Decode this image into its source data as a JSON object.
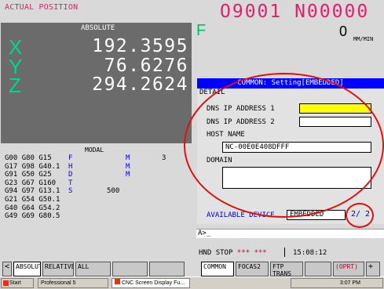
{
  "header": {
    "title": "ACTUAL POSITION",
    "program": "O9001 N00000"
  },
  "position": {
    "title": "ABSOLUTE",
    "axes": [
      {
        "name": "X",
        "value": "192.3595"
      },
      {
        "name": "Y",
        "value": "76.6276"
      },
      {
        "name": "Z",
        "value": "294.2624"
      }
    ]
  },
  "feed": {
    "label": "F",
    "value": "0",
    "unit": "MM/MIN"
  },
  "modal": {
    "title": "MODAL",
    "rows": [
      {
        "c1": "G00",
        "c2": "G80",
        "c3": "G15",
        "c4": "F",
        "c5": "",
        "c6": "M",
        "c7": "3"
      },
      {
        "c1": "G17",
        "c2": "G98",
        "c3": "G40.1",
        "c4": "H",
        "c5": "",
        "c6": "M",
        "c7": ""
      },
      {
        "c1": "G91",
        "c2": "G50",
        "c3": "G25",
        "c4": "D",
        "c5": "",
        "c6": "M",
        "c7": ""
      },
      {
        "c1": "G23",
        "c2": "G67",
        "c3": "G160",
        "c4": "T",
        "c5": "",
        "c6": "",
        "c7": ""
      },
      {
        "c1": "G94",
        "c2": "G97",
        "c3": "G13.1",
        "c4": "S",
        "c5": "500",
        "c6": "",
        "c7": ""
      },
      {
        "c1": "G21",
        "c2": "G54",
        "c3": "G50.1",
        "c4": "",
        "c5": "",
        "c6": "",
        "c7": ""
      },
      {
        "c1": "G40",
        "c2": "G64",
        "c3": "G54.2",
        "c4": "",
        "c5": "",
        "c6": "",
        "c7": ""
      },
      {
        "c1": "G49",
        "c2": "G69",
        "c3": "G80.5",
        "c4": "",
        "c5": "",
        "c6": "",
        "c7": ""
      }
    ]
  },
  "setting": {
    "title": "COMMON: Setting[EMBEDDED]",
    "section": "DETAIL",
    "dns1_label": "DNS IP ADDRESS 1",
    "dns1_value": "",
    "dns2_label": "DNS IP ADDRESS 2",
    "dns2_value": "",
    "host_label": "HOST NAME",
    "host_value": "NC-00E0E408DFFF",
    "domain_label": "DOMAIN",
    "domain_value": "",
    "device_label": "AVAILABLE DEVICE",
    "device_value": "EMBEDDED",
    "page": "2/ 2"
  },
  "command": {
    "prompt": "A>_"
  },
  "status": {
    "mode": "HND",
    "state": "STOP",
    "alarm": "*** ***",
    "time": "15:08:12"
  },
  "softkeys": {
    "prev": "<",
    "absolute": "ABSOLUTE",
    "relative": "RELATIVE",
    "all": "ALL",
    "common": "COMMON",
    "focas2": "FOCAS2",
    "ftp": "FTP TRANS",
    "oprt": "(OPRT)",
    "next": "+"
  },
  "taskbar": {
    "start": "Start",
    "item1": "Professional 5",
    "item2": "CNC Screen Display Fu...",
    "time": "3:07 PM"
  },
  "colors": {
    "accent_pink": "#e0206e",
    "axis_green": "#00d68f",
    "title_blue": "#0000ff",
    "annotation_red": "#e01010",
    "modal_blue": "#0000ff"
  }
}
